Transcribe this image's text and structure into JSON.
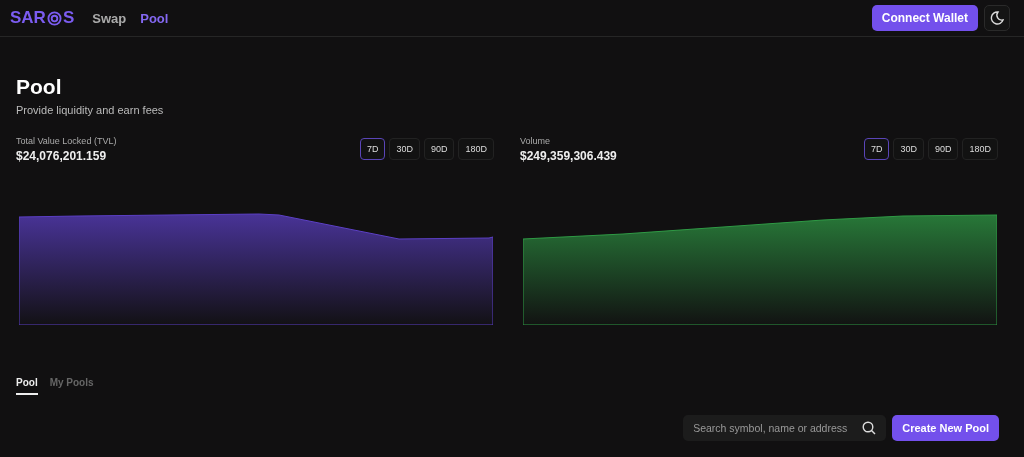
{
  "header": {
    "logo": "SAR",
    "logo_tail": "S",
    "nav": [
      {
        "label": "Swap",
        "selected": false
      },
      {
        "label": "Pool",
        "selected": true
      }
    ],
    "connect_button": "Connect Wallet"
  },
  "page": {
    "title": "Pool",
    "subtitle": "Provide liquidity and earn fees"
  },
  "panels": [
    {
      "kind": "tvl",
      "label": "Total Value Locked (TVL)",
      "value": "$24,076,201.159",
      "ranges": [
        {
          "label": "7D",
          "selected": true
        },
        {
          "label": "30D",
          "selected": false
        },
        {
          "label": "90D",
          "selected": false
        },
        {
          "label": "180D",
          "selected": false
        }
      ]
    },
    {
      "kind": "volume",
      "label": "Volume",
      "value": "$249,359,306.439",
      "ranges": [
        {
          "label": "7D",
          "selected": true
        },
        {
          "label": "30D",
          "selected": false
        },
        {
          "label": "90D",
          "selected": false
        },
        {
          "label": "180D",
          "selected": false
        }
      ]
    }
  ],
  "tabs": [
    {
      "label": "Pool",
      "selected": true
    },
    {
      "label": "My Pools",
      "selected": false
    }
  ],
  "search": {
    "placeholder": "Search symbol, name or address"
  },
  "create_button": "Create New Pool"
}
